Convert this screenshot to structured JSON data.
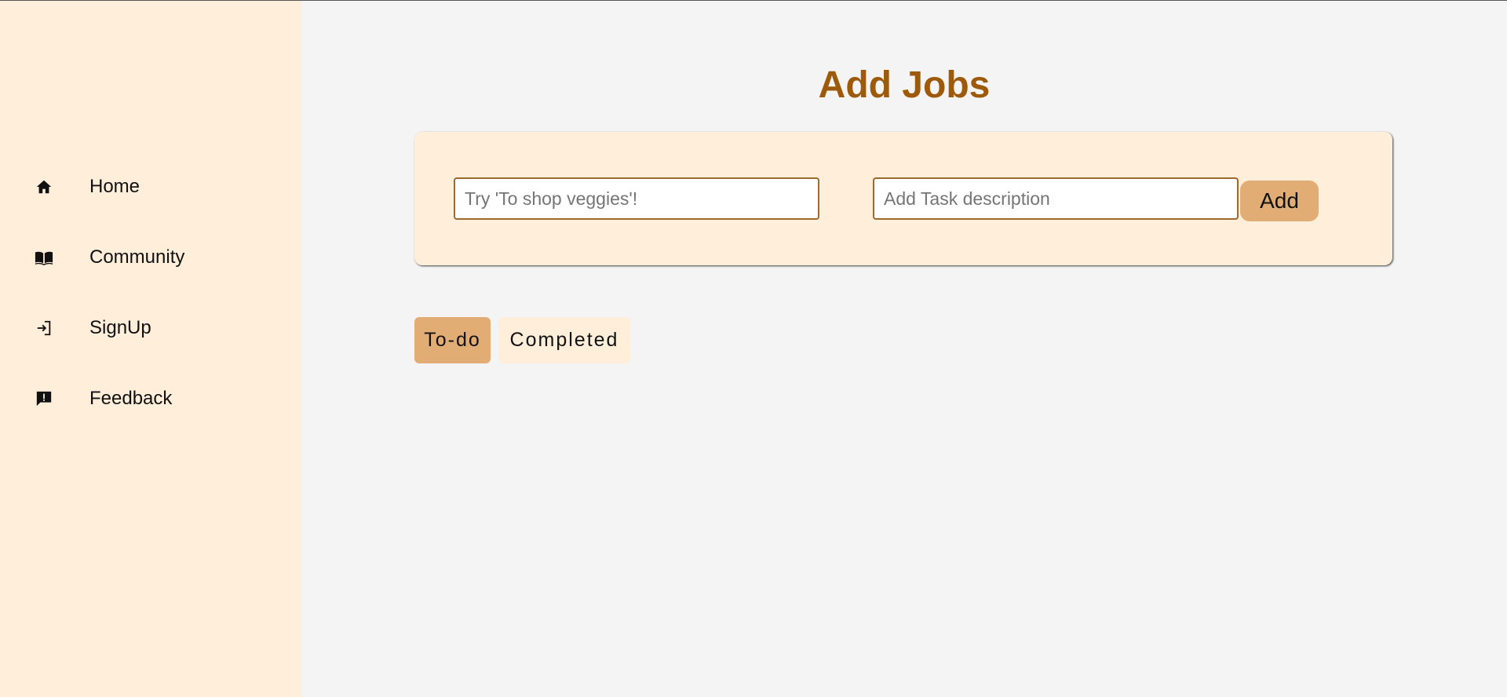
{
  "sidebar": {
    "items": [
      {
        "label": "Home",
        "icon": "home-icon"
      },
      {
        "label": "Community",
        "icon": "book-icon"
      },
      {
        "label": "SignUp",
        "icon": "sign-in-icon"
      },
      {
        "label": "Feedback",
        "icon": "feedback-icon"
      }
    ]
  },
  "main": {
    "title": "Add Jobs",
    "form": {
      "title_placeholder": "Try 'To shop veggies'!",
      "description_placeholder": "Add Task description",
      "add_label": "Add"
    },
    "tabs": [
      {
        "label": "To-do"
      },
      {
        "label": "Completed"
      }
    ]
  },
  "colors": {
    "sidebar_bg": "#ffeed9",
    "page_bg": "#f4f4f4",
    "title": "#9e5a0b",
    "accent": "#e2ad74"
  }
}
